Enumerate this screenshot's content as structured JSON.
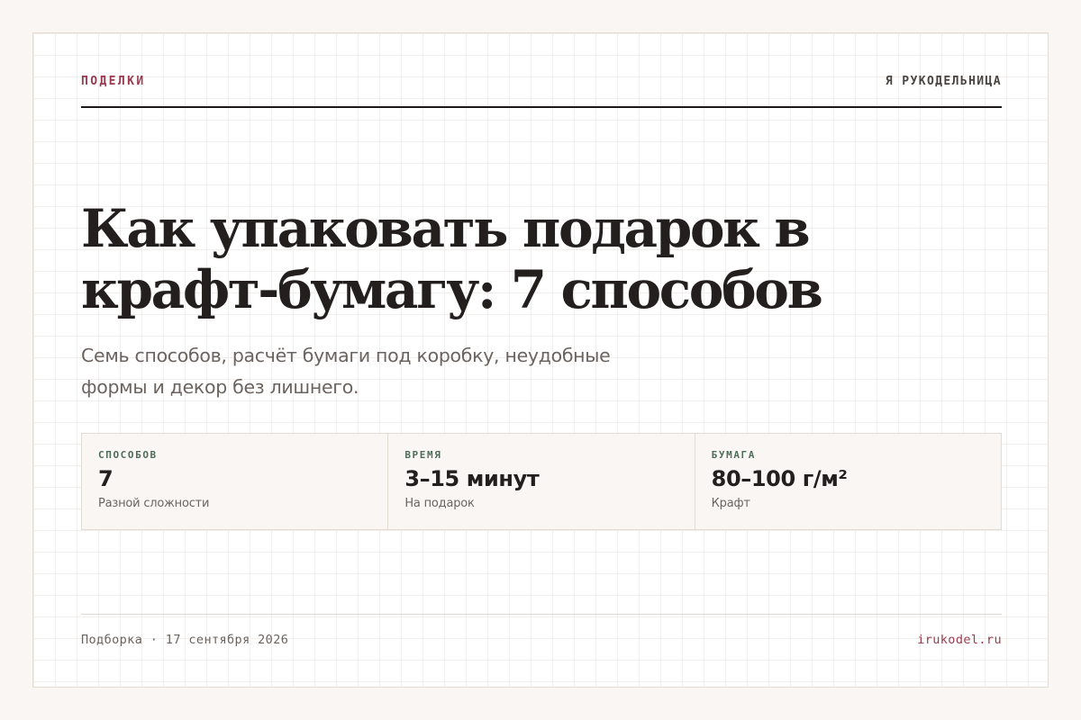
{
  "header": {
    "category": "ПОДЕЛКИ",
    "brand": "Я РУКОДЕЛЬНИЦА"
  },
  "article": {
    "title": "Как упаковать подарок в крафт-бумагу: 7 способов",
    "lede": "Семь способов, расчёт бумаги под коробку, неудобные формы и декор без лишнего."
  },
  "stats": [
    {
      "label": "СПОСОБОВ",
      "value": "7",
      "note": "Разной сложности"
    },
    {
      "label": "ВРЕМЯ",
      "value": "3–15 минут",
      "note": "На подарок"
    },
    {
      "label": "БУМАГА",
      "value": "80–100 г/м²",
      "note": "Крафт"
    }
  ],
  "footer": {
    "meta": "Подборка · 17 сентября 2026",
    "site": "irukodel.ru"
  },
  "colors": {
    "accent": "#9b3a4f",
    "label_green": "#4f6e5a",
    "ink": "#231f1e"
  }
}
